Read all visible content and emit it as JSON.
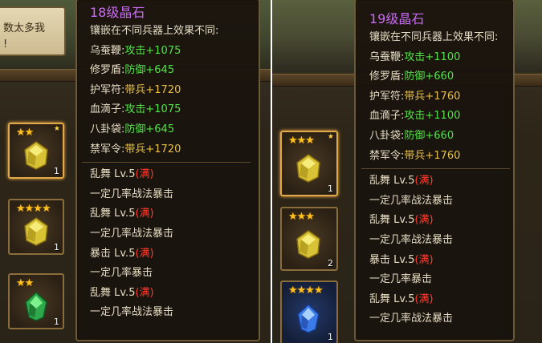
{
  "left": {
    "message_fragment": [
      "数太多我",
      "!"
    ],
    "tooltip": {
      "title": "18级晶石",
      "intro": "镶嵌在不同兵器上效果不同:",
      "bonuses": [
        {
          "weapon": "乌蚕鞭:",
          "effect": "攻击+1075"
        },
        {
          "weapon": "修罗盾:",
          "effect": "防御+645"
        },
        {
          "weapon": "护军符:",
          "effect": "带兵+1720"
        },
        {
          "weapon": "血滴子:",
          "effect": "攻击+1075"
        },
        {
          "weapon": "八卦袋:",
          "effect": "防御+645"
        },
        {
          "weapon": "禁军令:",
          "effect": "带兵+1720"
        }
      ],
      "skills": [
        {
          "name": "乱舞 Lv.5",
          "status": "(满)",
          "desc": "一定几率战法暴击"
        },
        {
          "name": "乱舞 Lv.5",
          "status": "(满)",
          "desc": "一定几率战法暴击"
        },
        {
          "name": "暴击 Lv.5",
          "status": "(满)",
          "desc": "一定几率暴击"
        },
        {
          "name": "乱舞 Lv.5",
          "status": "(满)",
          "desc": "一定几率战法暴击"
        }
      ]
    },
    "slots": [
      {
        "stars": "★★",
        "count": "1",
        "gem": "yellow",
        "marked": true
      },
      {
        "stars": "★★★★",
        "count": "1",
        "gem": "yellow",
        "marked": false
      },
      {
        "stars": "★★",
        "count": "1",
        "gem": "green",
        "marked": false
      }
    ]
  },
  "right": {
    "tooltip": {
      "title": "19级晶石",
      "intro": "镶嵌在不同兵器上效果不同:",
      "bonuses": [
        {
          "weapon": "乌蚕鞭:",
          "effect": "攻击+1100"
        },
        {
          "weapon": "修罗盾:",
          "effect": "防御+660"
        },
        {
          "weapon": "护军符:",
          "effect": "带兵+1760"
        },
        {
          "weapon": "血滴子:",
          "effect": "攻击+1100"
        },
        {
          "weapon": "八卦袋:",
          "effect": "防御+660"
        },
        {
          "weapon": "禁军令:",
          "effect": "带兵+1760"
        }
      ],
      "skills": [
        {
          "name": "乱舞 Lv.5",
          "status": "(满)",
          "desc": "一定几率战法暴击"
        },
        {
          "name": "乱舞 Lv.5",
          "status": "(满)",
          "desc": "一定几率战法暴击"
        },
        {
          "name": "暴击 Lv.5",
          "status": "(满)",
          "desc": "一定几率暴击"
        },
        {
          "name": "乱舞 Lv.5",
          "status": "(满)",
          "desc": "一定几率战法暴击"
        }
      ]
    },
    "slots": [
      {
        "stars": "★★★",
        "count": "1",
        "gem": "yellow",
        "marked": true
      },
      {
        "stars": "★★★",
        "count": "2",
        "gem": "yellow",
        "marked": false
      },
      {
        "stars": "★★★★",
        "count": "1",
        "gem": "blue",
        "marked": false
      }
    ]
  },
  "colors": {
    "title": "#c86cf2",
    "bonus_attack_defense": "#56e04a",
    "bonus_troops": "#e6c04a",
    "full_status": "#ff3b2d",
    "star": "#ffc21e"
  }
}
